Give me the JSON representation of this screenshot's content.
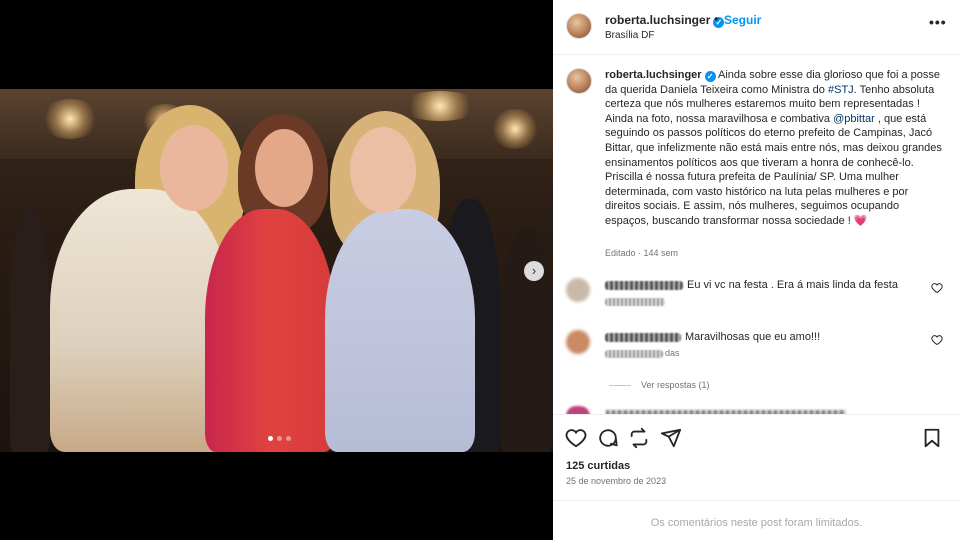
{
  "header": {
    "username": "roberta.luchsinger",
    "separator": "•",
    "follow_label": "Seguir",
    "location": "Brasília DF",
    "more_label": "•••"
  },
  "caption": {
    "username": "roberta.luchsinger",
    "text_part1": "Ainda sobre esse dia glorioso que foi a posse da querida Daniela Teixeira como Ministra do ",
    "hashtag": "#STJ",
    "text_part2": ". Tenho absoluta certeza que nós mulheres estaremos muito bem representadas ! Ainda na foto, nossa maravilhosa e combativa ",
    "mention": "@pbittar",
    "text_part3": " , que está seguindo os passos políticos do eterno prefeito de Campinas, Jacó Bittar, que infelizmente não está mais entre nós, mas deixou grandes ensinamentos políticos aos que tiveram a honra de conhecê-lo. Priscilla é nossa futura prefeita de Paulínia/ SP. Uma mulher determinada, com vasto histórico na luta pelas mulheres e por direitos sociais. E assim, nós mulheres, seguimos ocupando espaços, buscando transformar nossa sociedade ! ",
    "emoji": "💗",
    "meta": "Editado · 144 sem"
  },
  "comments": [
    {
      "text": "Eu vi vc na festa . Era á mais linda da festa",
      "meta_suffix": "",
      "avatar_color": "#c9b9a8"
    },
    {
      "text": "Maravilhosas que eu amo!!!",
      "meta_suffix": "das",
      "avatar_color": "#c98a64"
    }
  ],
  "replies_label": "Ver respostas (1)",
  "likes": "125 curtidas",
  "date": "25 de novembro de 2023",
  "limited_notice": "Os comentários neste post foram limitados.",
  "carousel": {
    "next_icon": "chevron-right-icon",
    "slide_count": 3,
    "active_slide": 1
  },
  "colors": {
    "accent": "#0095f6",
    "link": "#00376b",
    "heart_emoji": "#ed4a7b"
  }
}
